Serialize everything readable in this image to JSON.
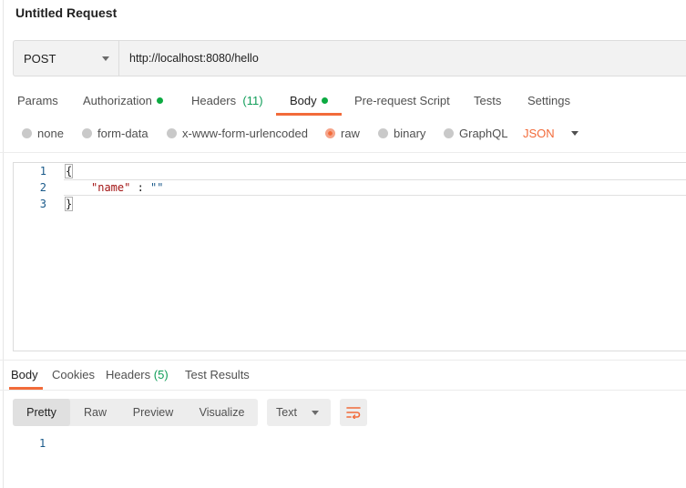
{
  "request": {
    "title": "Untitled Request",
    "method": "POST",
    "url": "http://localhost:8080/hello"
  },
  "request_tabs": [
    {
      "label": "Params"
    },
    {
      "label": "Authorization",
      "has_dot": true
    },
    {
      "label": "Headers",
      "count": "(11)"
    },
    {
      "label": "Body",
      "has_dot": true,
      "active": true
    },
    {
      "label": "Pre-request Script"
    },
    {
      "label": "Tests"
    },
    {
      "label": "Settings"
    }
  ],
  "body_types": {
    "options": [
      "none",
      "form-data",
      "x-www-form-urlencoded",
      "raw",
      "binary",
      "GraphQL"
    ],
    "selected": "raw",
    "language": "JSON"
  },
  "editor": {
    "line_numbers": [
      "1",
      "2",
      "3"
    ],
    "lines": {
      "l1": "{",
      "l2_key": "\"name\"",
      "l2_sep": " : ",
      "l2_val": "\"\"",
      "l3": "}"
    }
  },
  "response_tabs": [
    {
      "label": "Body",
      "active": true
    },
    {
      "label": "Cookies"
    },
    {
      "label": "Headers",
      "count": "(5)"
    },
    {
      "label": "Test Results"
    }
  ],
  "response_view": {
    "modes": [
      "Pretty",
      "Raw",
      "Preview",
      "Visualize"
    ],
    "active_mode": "Pretty",
    "format": "Text",
    "line_numbers": [
      "1"
    ]
  },
  "colors": {
    "accent": "#f26b3a",
    "status_dot": "#0caa41",
    "count": "#0f9d58"
  },
  "icons": {
    "method_dropdown": "chevron-down-icon",
    "language_dropdown": "chevron-down-icon",
    "format_dropdown": "chevron-down-icon",
    "wrap": "wrap-lines-icon"
  }
}
